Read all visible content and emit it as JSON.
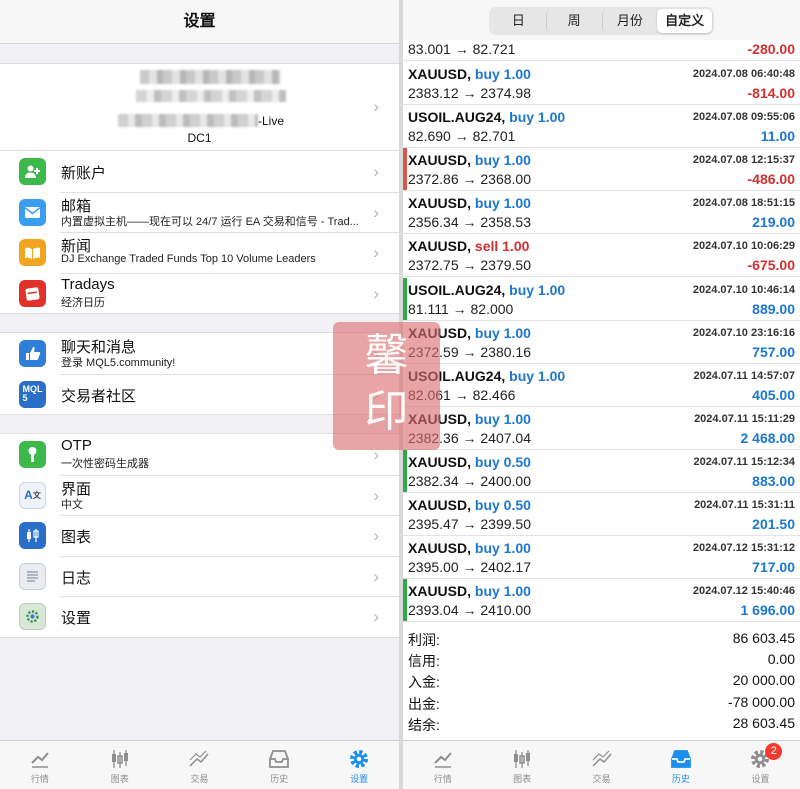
{
  "left": {
    "title": "设置",
    "account": {
      "live_suffix": "-Live",
      "server": "DC1"
    },
    "group1": [
      {
        "icon": "new-account-icon",
        "title": "新账户",
        "sub": ""
      },
      {
        "icon": "mail-icon",
        "title": "邮箱",
        "sub": "内置虚拟主机——现在可以 24/7 运行 EA 交易和信号 - Trad..."
      },
      {
        "icon": "news-icon",
        "title": "新闻",
        "sub": "DJ Exchange Traded Funds Top 10 Volume Leaders"
      },
      {
        "icon": "tradays-icon",
        "title": "Tradays",
        "sub": "经济日历"
      }
    ],
    "group2": [
      {
        "icon": "chat-icon",
        "title": "聊天和消息",
        "sub": "登录 MQL5.community!"
      },
      {
        "icon": "mql5-icon",
        "title": "交易者社区",
        "sub": ""
      }
    ],
    "group3": [
      {
        "icon": "otp-icon",
        "title": "OTP",
        "sub": "一次性密码生成器"
      },
      {
        "icon": "language-icon",
        "title": "界面",
        "sub": "中文"
      },
      {
        "icon": "chart-icon",
        "title": "图表",
        "sub": ""
      },
      {
        "icon": "journal-icon",
        "title": "日志",
        "sub": ""
      },
      {
        "icon": "settings-icon",
        "title": "设置",
        "sub": ""
      }
    ],
    "tabs": [
      "行情",
      "图表",
      "交易",
      "历史",
      "设置"
    ]
  },
  "right": {
    "segments": [
      "日",
      "周",
      "月份",
      "自定义"
    ],
    "first_deal": {
      "prices": "83.001 → 82.721",
      "profit": "-280.00"
    },
    "deals": [
      {
        "symbol": "XAUUSD,",
        "type": "buy 1.00",
        "time": "2024.07.08 06:40:48",
        "prices": "2383.12 → 2374.98",
        "profit": "-814.00",
        "bar": ""
      },
      {
        "symbol": "USOIL.AUG24,",
        "type": "buy 1.00",
        "time": "2024.07.08 09:55:06",
        "prices": "82.690 → 82.701",
        "profit": "11.00",
        "bar": ""
      },
      {
        "symbol": "XAUUSD,",
        "type": "buy 1.00",
        "time": "2024.07.08 12:15:37",
        "prices": "2372.86 → 2368.00",
        "profit": "-486.00",
        "bar": "#d9534f"
      },
      {
        "symbol": "XAUUSD,",
        "type": "buy 1.00",
        "time": "2024.07.08 18:51:15",
        "prices": "2356.34 → 2358.53",
        "profit": "219.00",
        "bar": ""
      },
      {
        "symbol": "XAUUSD,",
        "type": "sell 1.00",
        "time": "2024.07.10 10:06:29",
        "prices": "2372.75 → 2379.50",
        "profit": "-675.00",
        "bar": ""
      },
      {
        "symbol": "USOIL.AUG24,",
        "type": "buy 1.00",
        "time": "2024.07.10 10:46:14",
        "prices": "81.111 → 82.000",
        "profit": "889.00",
        "bar": "#2eaa4a"
      },
      {
        "symbol": "XAUUSD,",
        "type": "buy 1.00",
        "time": "2024.07.10 23:16:16",
        "prices": "2372.59 → 2380.16",
        "profit": "757.00",
        "bar": ""
      },
      {
        "symbol": "USOIL.AUG24,",
        "type": "buy 1.00",
        "time": "2024.07.11 14:57:07",
        "prices": "82.061 → 82.466",
        "profit": "405.00",
        "bar": ""
      },
      {
        "symbol": "XAUUSD,",
        "type": "buy 1.00",
        "time": "2024.07.11 15:11:29",
        "prices": "2382.36 → 2407.04",
        "profit": "2 468.00",
        "bar": ""
      },
      {
        "symbol": "XAUUSD,",
        "type": "buy 0.50",
        "time": "2024.07.11 15:12:34",
        "prices": "2382.34 → 2400.00",
        "profit": "883.00",
        "bar": "#2eaa4a"
      },
      {
        "symbol": "XAUUSD,",
        "type": "buy 0.50",
        "time": "2024.07.11 15:31:11",
        "prices": "2395.47 → 2399.50",
        "profit": "201.50",
        "bar": ""
      },
      {
        "symbol": "XAUUSD,",
        "type": "buy 1.00",
        "time": "2024.07.12 15:31:12",
        "prices": "2395.00 → 2402.17",
        "profit": "717.00",
        "bar": ""
      },
      {
        "symbol": "XAUUSD,",
        "type": "buy 1.00",
        "time": "2024.07.12 15:40:46",
        "prices": "2393.04 → 2410.00",
        "profit": "1 696.00",
        "bar": "#2eaa4a"
      }
    ],
    "summary": [
      {
        "label": "利润:",
        "value": "86 603.45"
      },
      {
        "label": "信用:",
        "value": "0.00"
      },
      {
        "label": "入金:",
        "value": "20 000.00"
      },
      {
        "label": "出金:",
        "value": "-78 000.00"
      },
      {
        "label": "结余:",
        "value": "28 603.45"
      }
    ],
    "tabs": [
      "行情",
      "图表",
      "交易",
      "历史",
      "设置"
    ],
    "badge": "2"
  },
  "stamp": {
    "text1": "馨",
    "text2": "印"
  },
  "colors": {
    "accent": "#1b8ff0",
    "buy": "#1b77d2",
    "sell": "#d32f2f",
    "loss_bar": "#d9534f",
    "profit_bar": "#2eaa4a"
  }
}
